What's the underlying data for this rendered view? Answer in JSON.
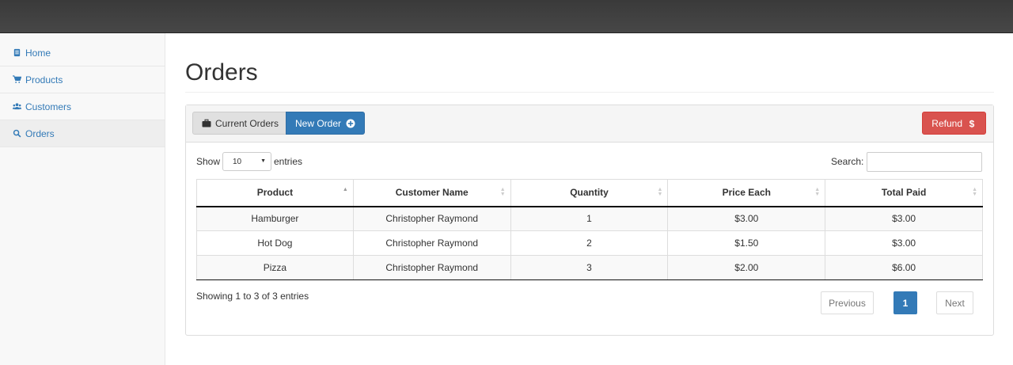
{
  "sidebar": {
    "items": [
      {
        "label": "Home",
        "icon": "book-icon"
      },
      {
        "label": "Products",
        "icon": "cart-icon"
      },
      {
        "label": "Customers",
        "icon": "users-icon"
      },
      {
        "label": "Orders",
        "icon": "search-icon"
      }
    ]
  },
  "page": {
    "title": "Orders"
  },
  "toolbar": {
    "current_orders_label": "Current Orders",
    "new_order_label": "New Order",
    "refund_label": "Refund"
  },
  "controls": {
    "show_label": "Show",
    "page_size": "10",
    "entries_label": "entries",
    "search_label": "Search:",
    "search_value": ""
  },
  "table": {
    "columns": [
      "Product",
      "Customer Name",
      "Quantity",
      "Price Each",
      "Total Paid"
    ],
    "rows": [
      [
        "Hamburger",
        "Christopher Raymond",
        "1",
        "$3.00",
        "$3.00"
      ],
      [
        "Hot Dog",
        "Christopher Raymond",
        "2",
        "$1.50",
        "$3.00"
      ],
      [
        "Pizza",
        "Christopher Raymond",
        "3",
        "$2.00",
        "$6.00"
      ]
    ]
  },
  "footer": {
    "info": "Showing 1 to 3 of 3 entries",
    "previous_label": "Previous",
    "page_label": "1",
    "next_label": "Next"
  },
  "colors": {
    "primary": "#337ab7",
    "danger": "#d9534f",
    "topbar": "#424242"
  }
}
